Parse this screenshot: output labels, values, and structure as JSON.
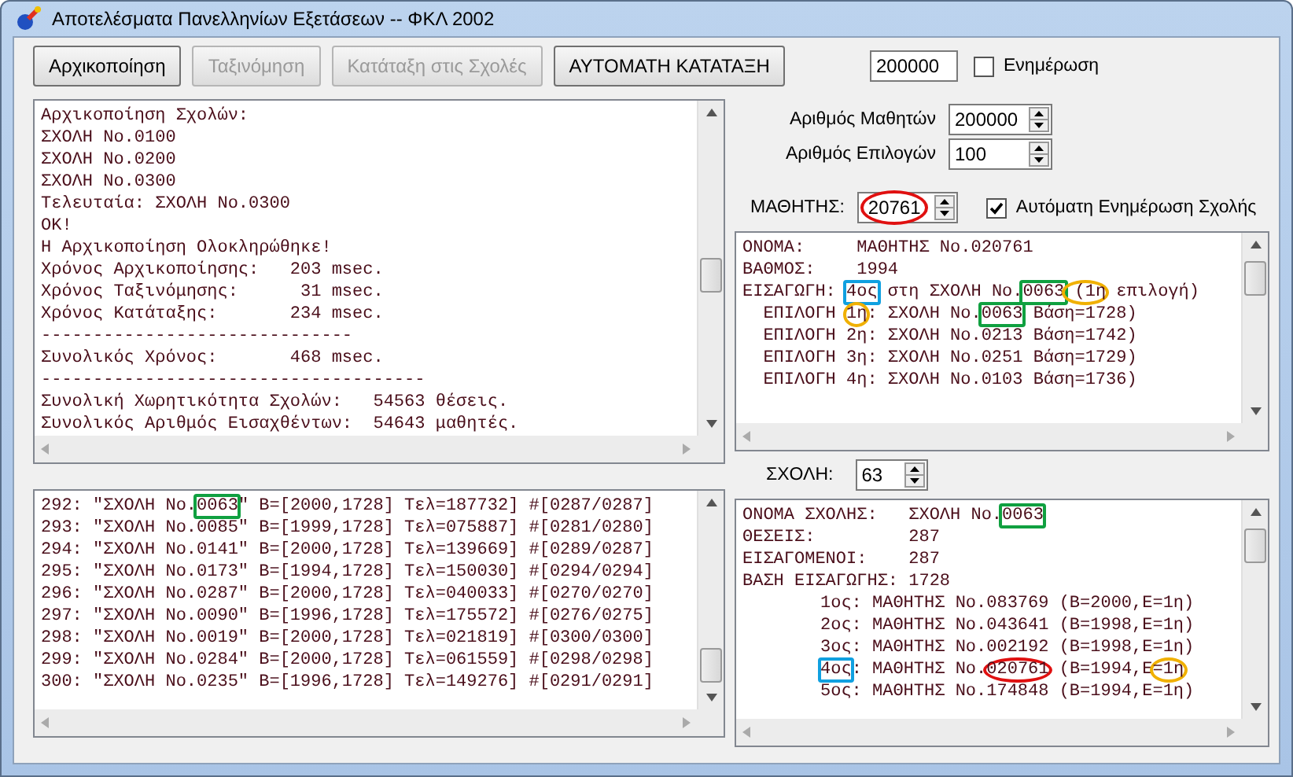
{
  "window": {
    "title": "Αποτελέσματα Πανελληνίων Εξετάσεων -- ΦΚΛ 2002"
  },
  "buttons": [
    {
      "label": "Αρχικοποίηση",
      "disabled": false
    },
    {
      "label": "Ταξινόμηση",
      "disabled": true
    },
    {
      "label": "Κατάταξη στις Σχολές",
      "disabled": true
    },
    {
      "label": "ΑΥΤΟΜΑΤΗ ΚΑΤΑΤΑΞΗ",
      "disabled": false
    }
  ],
  "log": {
    "lines": [
      "Αρχικοποίηση Σχολών:",
      "ΣΧΟΛΗ No.0100",
      "ΣΧΟΛΗ No.0200",
      "ΣΧΟΛΗ No.0300",
      "Τελευταία: ΣΧΟΛΗ No.0300",
      "OK!",
      "Η Αρχικοποίηση Ολοκληρώθηκε!",
      "Χρόνος Αρχικοποίησης:   203 msec.",
      "Χρόνος Ταξινόμησης:      31 msec.",
      "Χρόνος Κατάταξης:       234 msec.",
      "------------------------------",
      "Συνολικός Χρόνος:       468 msec.",
      "-------------------------------------",
      "Συνολική Χωρητικότητα Σχολών:   54563 θέσεις.",
      "Συνολικός Αριθμός Εισαχθέντων:  54643 μαθητές."
    ]
  },
  "school_list": {
    "lines": [
      {
        "segments": [
          {
            "text": "292: \"ΣΧΟΛΗ No."
          },
          {
            "text": "0063",
            "kind": "box",
            "color": "#10a040"
          },
          {
            "text": "\" B=[2000,1728] Τελ=187732] #[0287/0287]"
          }
        ]
      },
      {
        "segments": [
          {
            "text": "293: \"ΣΧΟΛΗ No.0085\" B=[1999,1728] Τελ=075887] #[0281/0280]"
          }
        ]
      },
      {
        "segments": [
          {
            "text": "294: \"ΣΧΟΛΗ No.0141\" B=[2000,1728] Τελ=139669] #[0289/0287]"
          }
        ]
      },
      {
        "segments": [
          {
            "text": "295: \"ΣΧΟΛΗ No.0173\" B=[1994,1728] Τελ=150030] #[0294/0294]"
          }
        ]
      },
      {
        "segments": [
          {
            "text": "296: \"ΣΧΟΛΗ No.0287\" B=[2000,1728] Τελ=040033] #[0270/0270]"
          }
        ]
      },
      {
        "segments": [
          {
            "text": "297: \"ΣΧΟΛΗ No.0090\" B=[1996,1728] Τελ=175572] #[0276/0275]"
          }
        ]
      },
      {
        "segments": [
          {
            "text": "298: \"ΣΧΟΛΗ No.0019\" B=[2000,1728] Τελ=021819] #[0300/0300]"
          }
        ]
      },
      {
        "segments": [
          {
            "text": "299: \"ΣΧΟΛΗ No.0284\" B=[2000,1728] Τελ=061559] #[0298/0298]"
          }
        ]
      },
      {
        "segments": [
          {
            "text": "300: \"ΣΧΟΛΗ No.0235\" B=[1996,1728] Τελ=149276] #[0291/0291]"
          }
        ]
      }
    ]
  },
  "settings": {
    "value": "200000",
    "update": {
      "label": "Ενημέρωση",
      "checked": false
    }
  },
  "spinners": [
    {
      "label": "Αριθμός Μαθητών",
      "value": "200000"
    },
    {
      "label": "Αριθμός Επιλογών",
      "value": "100"
    }
  ],
  "student": {
    "label": "ΜΑΘΗΤΗΣ:",
    "value": "20761",
    "kind": "ellipse",
    "color": "#e01010",
    "auto_update": {
      "label": "Αυτόματη Ενημέρωση Σχολής",
      "checked": true
    }
  },
  "student_panel": {
    "lines": [
      {
        "segments": [
          {
            "text": "ΟΝΟΜΑ:     ΜΑΘΗΤΗΣ No.020761"
          }
        ]
      },
      {
        "segments": [
          {
            "text": "ΒΑΘΜΟΣ:    1994"
          }
        ]
      },
      {
        "segments": [
          {
            "text": "ΕΙΣΑΓΩΓΗ: "
          },
          {
            "text": "4ος",
            "kind": "box",
            "color": "#10a0e0"
          },
          {
            "text": " στη ΣΧΟΛΗ No."
          },
          {
            "text": "0063",
            "kind": "box",
            "color": "#10a040"
          },
          {
            "text": " (1η",
            "kind": "ellipse",
            "color": "#f0b000"
          },
          {
            "text": " επιλογή)"
          }
        ]
      },
      {
        "segments": [
          {
            "text": "  ΕΠΙΛΟΓΗ "
          },
          {
            "text": "1η",
            "kind": "ellipse",
            "color": "#f0b000"
          },
          {
            "text": ": ΣΧΟΛΗ No."
          },
          {
            "text": "0063",
            "kind": "box",
            "color": "#10a040"
          },
          {
            "text": " Βάση=1728)"
          }
        ]
      },
      {
        "segments": [
          {
            "text": "  ΕΠΙΛΟΓΗ 2η: ΣΧΟΛΗ No.0213 Βάση=1742)"
          }
        ]
      },
      {
        "segments": [
          {
            "text": "  ΕΠΙΛΟΓΗ 3η: ΣΧΟΛΗ No.0251 Βάση=1729)"
          }
        ]
      },
      {
        "segments": [
          {
            "text": "  ΕΠΙΛΟΓΗ 4η: ΣΧΟΛΗ No.0103 Βάση=1736)"
          }
        ]
      }
    ]
  },
  "school": {
    "label": "ΣΧΟΛΗ:",
    "value": "63"
  },
  "school_panel": {
    "lines": [
      {
        "segments": [
          {
            "text": "ΟΝΟΜΑ ΣΧΟΛΗΣ:   ΣΧΟΛΗ No."
          },
          {
            "text": "0063",
            "kind": "box",
            "color": "#10a040"
          }
        ]
      },
      {
        "segments": [
          {
            "text": "ΘΕΣΕΙΣ:         287"
          }
        ]
      },
      {
        "segments": [
          {
            "text": "ΕΙΣΑΓΟΜΕΝΟΙ:    287"
          }
        ]
      },
      {
        "segments": [
          {
            "text": "ΒΑΣΗ ΕΙΣΑΓΩΓΗΣ: 1728"
          }
        ]
      },
      {
        "kind": "ranked",
        "segments": [
          {
            "text": "1ος: ΜΑΘΗΤΗΣ No.083769 (B=2000,E=1η)"
          }
        ]
      },
      {
        "kind": "ranked",
        "segments": [
          {
            "text": "2ος: ΜΑΘΗΤΗΣ No.043641 (B=1998,E=1η)"
          }
        ]
      },
      {
        "kind": "ranked",
        "segments": [
          {
            "text": "3ος: ΜΑΘΗΤΗΣ No.002192 (B=1998,E=1η)"
          }
        ]
      },
      {
        "kind": "ranked",
        "segments": [
          {
            "text": "4ος",
            "kind": "box",
            "color": "#10a0e0"
          },
          {
            "text": ": ΜΑΘΗΤΗΣ No."
          },
          {
            "text": "020761",
            "kind": "ellipse",
            "color": "#e01010"
          },
          {
            "text": " (B=1994,E"
          },
          {
            "text": "=1η",
            "kind": "ellipse",
            "color": "#f0b000"
          }
        ]
      },
      {
        "kind": "ranked",
        "segments": [
          {
            "text": "5ος: ΜΑΘΗΤΗΣ No.174848 (B=1994,E=1η)"
          }
        ]
      }
    ]
  }
}
